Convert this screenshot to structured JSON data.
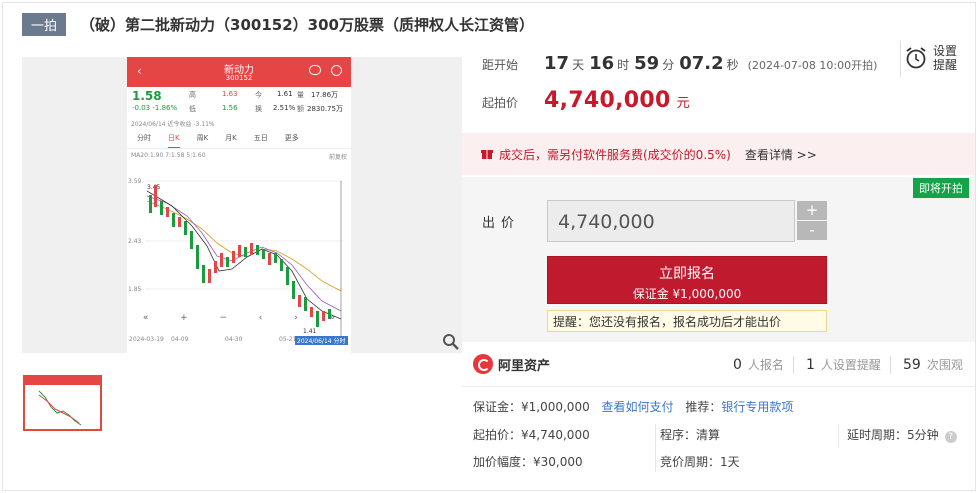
{
  "header": {
    "tag": "一拍",
    "title": "（破）第二批新动力（300152）300万股票（质押权人长江资管）"
  },
  "phone": {
    "title": "新动力",
    "code": "300152",
    "price": "1.58",
    "change": "-0.03",
    "change_pct": "-1.86%",
    "q_high_label": "高",
    "q_high": "1.63",
    "q_low_label": "低",
    "q_low": "1.56",
    "q_today_label": "今",
    "q_today": "1.61",
    "q_turn_label": "换",
    "q_turn": "2.51%",
    "q_vol_label": "量",
    "q_vol": "17.86万",
    "q_amt_label": "额",
    "q_amt": "2830.75万",
    "date_line": "2024/06/14  近今收益 -3.11%",
    "tabs": [
      "分时",
      "日K",
      "周K",
      "月K",
      "五日",
      "更多"
    ],
    "legend": "MA20:1.90  7:1.58  5:1.60",
    "legend_right": "前复权",
    "y_ticks": [
      "3.59",
      "2.43",
      "1.85"
    ],
    "hi_label": "3.45",
    "lo_label": "1.41",
    "dates": [
      "2024-03-19",
      "04-09",
      "04-30",
      "05-21"
    ],
    "current_date": "2024/06/14 分时"
  },
  "countdown": {
    "label": "距开始",
    "days": "17",
    "days_unit": "天",
    "hours": "16",
    "hours_unit": "时",
    "minutes": "59",
    "minutes_unit": "分",
    "seconds": "07.2",
    "seconds_unit": "秒",
    "start_note": "(2024-07-08 10:00开拍)"
  },
  "reminder": {
    "label": "设置提醒"
  },
  "start_price": {
    "label": "起拍价",
    "value": "4,740,000",
    "unit": "元"
  },
  "notice": {
    "text": "成交后，需另付软件服务费(成交价的0.5%)",
    "link": "查看详情 >>"
  },
  "status_badge": "即将开拍",
  "bid": {
    "label": "出价",
    "value": "4,740,000",
    "plus": "+",
    "minus": "-"
  },
  "signup": {
    "label": "立即报名",
    "deposit": "保证金 ¥1,000,000"
  },
  "tip": "提醒：您还没有报名，报名成功后才能出价",
  "platform": {
    "name": "阿里资产"
  },
  "stats": [
    {
      "count": "0",
      "label": "人报名"
    },
    {
      "count": "1",
      "label": "人设置提醒"
    },
    {
      "count": "59",
      "label": "次围观"
    }
  ],
  "details": {
    "deposit": "保证金：¥1,000,000",
    "pay_link": "查看如何支付",
    "recommend": "推荐：",
    "bank_link": "银行专用款项",
    "start": "起拍价：¥4,740,000",
    "process": "程序：清算",
    "delay": "延时周期：5分钟",
    "increment": "加价幅度：¥30,000",
    "cycle": "竞价周期：1天"
  },
  "colors": {
    "accent": "#c01a2f",
    "up": "#e64545",
    "down": "#1a9c3e",
    "badge": "#15a34a"
  }
}
